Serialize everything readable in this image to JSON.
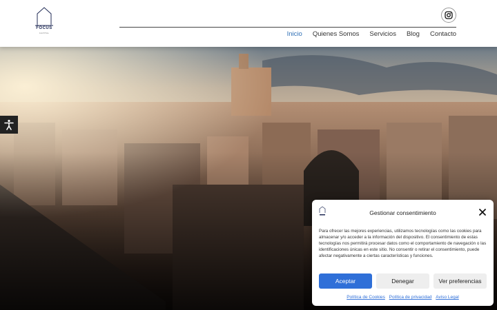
{
  "brand": {
    "name": "FOCUS",
    "tagline": "CAPITAL"
  },
  "nav": {
    "items": [
      {
        "label": "Inicio",
        "active": true
      },
      {
        "label": "Quienes Somos"
      },
      {
        "label": "Servicios"
      },
      {
        "label": "Blog"
      },
      {
        "label": "Contacto"
      }
    ]
  },
  "social": {
    "icon": "instagram-icon"
  },
  "accessibility": {
    "icon": "accessibility-icon"
  },
  "consent": {
    "title": "Gestionar consentimiento",
    "body": "Para ofrecer las mejores experiencias, utilizamos tecnologías como las cookies para almacenar y/o acceder a la información del dispositivo. El consentimiento de estas tecnologías nos permitirá procesar datos como el comportamiento de navegación o las identificaciones únicas en este sitio. No consentir o retirar el consentimiento, puede afectar negativamente a ciertas características y funciones.",
    "accept": "Aceptar",
    "deny": "Denegar",
    "preferences": "Ver preferencias",
    "links": [
      "Política de Cookies",
      "Política de privacidad",
      "Aviso Legal"
    ]
  },
  "colors": {
    "accent": "#2f6fd8",
    "nav_active": "#2f6fb5",
    "logo": "#1f2a55"
  }
}
